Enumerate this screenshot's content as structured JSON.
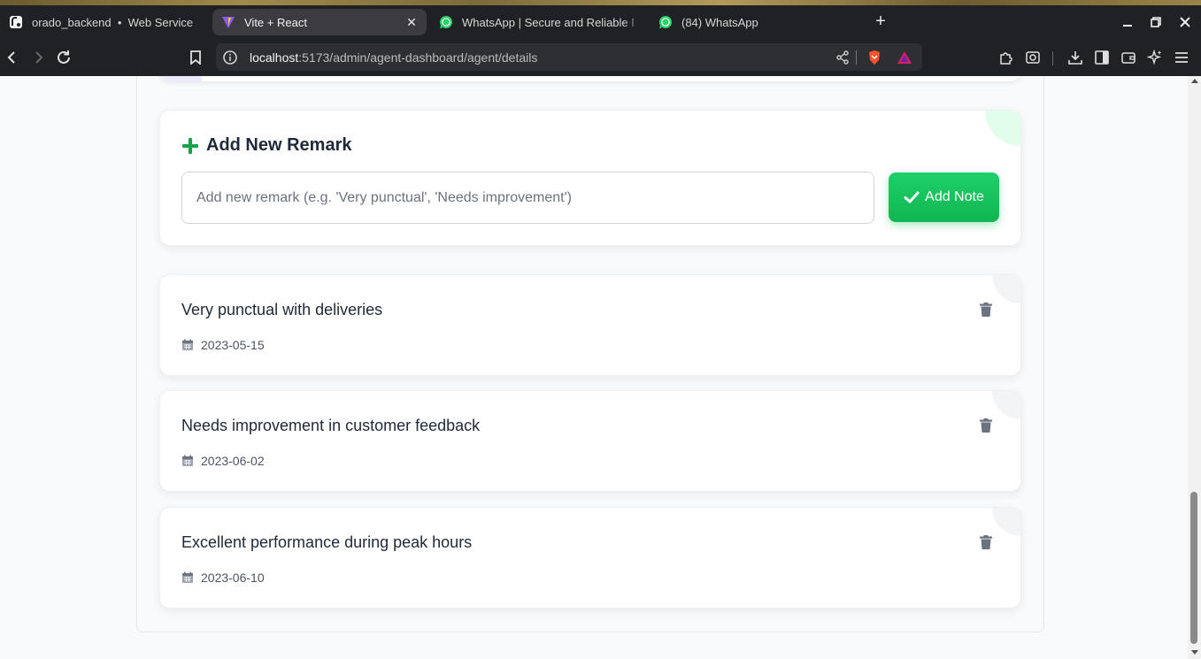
{
  "browser": {
    "tabs": [
      {
        "title": "orado_backend",
        "subtitle": "Web Service",
        "icon": "render-icon"
      },
      {
        "title": "Vite + React",
        "icon": "vite-icon",
        "active": true
      },
      {
        "title": "WhatsApp | Secure and Reliable F",
        "icon": "whatsapp-icon"
      },
      {
        "title": "(84) WhatsApp",
        "icon": "whatsapp-icon"
      }
    ],
    "url_host": "localhost",
    "url_path": ":5173/admin/agent-dashboard/agent/details",
    "colors": {
      "chrome_bg": "#202124",
      "active_tab": "#3c3c40"
    }
  },
  "remark_form": {
    "title": "Add New Remark",
    "input_value": "",
    "input_placeholder": "Add new remark (e.g. 'Very punctual', 'Needs improvement')",
    "button_label": "Add Note",
    "icon": "plus-icon",
    "button_icon": "check-icon",
    "accent_color": "#16c35c"
  },
  "remarks": [
    {
      "text": "Very punctual with deliveries",
      "date": "2023-05-15"
    },
    {
      "text": "Needs improvement in customer feedback",
      "date": "2023-06-02"
    },
    {
      "text": "Excellent performance during peak hours",
      "date": "2023-06-10"
    }
  ],
  "remark_icons": {
    "date": "calendar-icon",
    "delete": "trash-icon"
  }
}
